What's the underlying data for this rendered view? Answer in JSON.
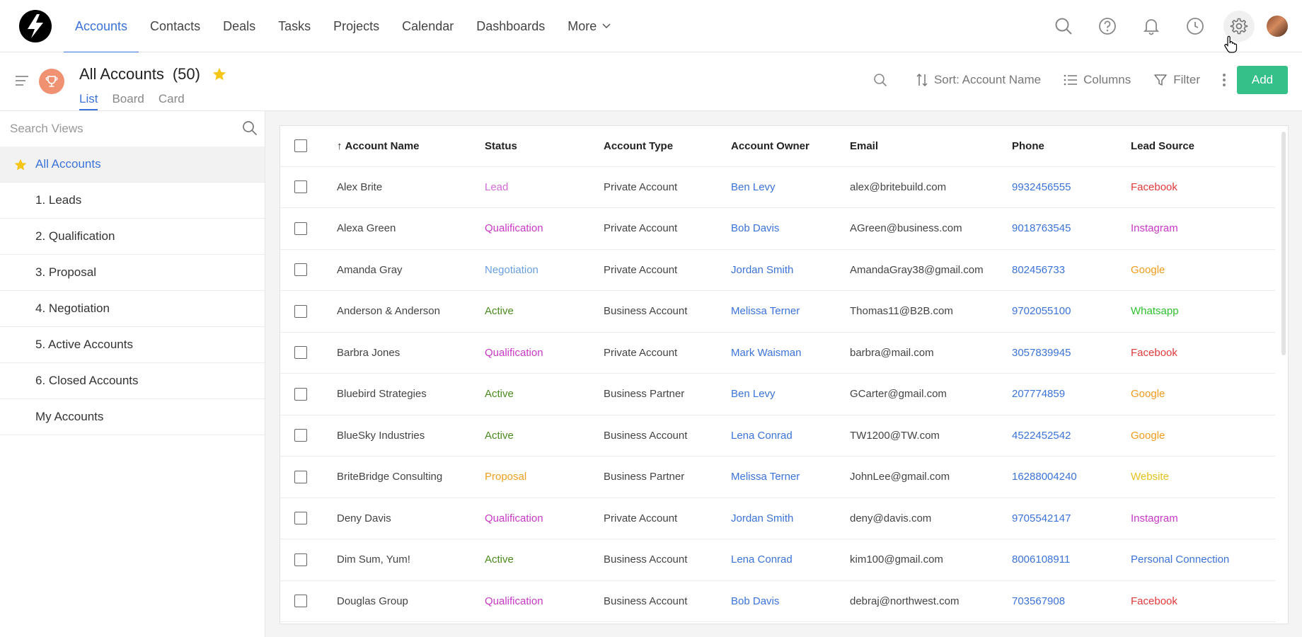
{
  "nav": {
    "items": [
      {
        "label": "Accounts",
        "active": true
      },
      {
        "label": "Contacts"
      },
      {
        "label": "Deals"
      },
      {
        "label": "Tasks"
      },
      {
        "label": "Projects"
      },
      {
        "label": "Calendar"
      },
      {
        "label": "Dashboards"
      }
    ],
    "more_label": "More",
    "icons": [
      "search-icon",
      "help-icon",
      "bell-icon",
      "clock-icon",
      "gear-icon",
      "avatar"
    ]
  },
  "header": {
    "title": "All Accounts",
    "count": "(50)",
    "tabs": [
      "List",
      "Board",
      "Card"
    ],
    "active_tab": "List",
    "sort_label": "Sort: Account Name",
    "columns_label": "Columns",
    "filter_label": "Filter",
    "add_label": "Add"
  },
  "sidebar": {
    "search_placeholder": "Search Views",
    "views": [
      {
        "label": "All Accounts",
        "active": true,
        "starred": true
      },
      {
        "label": "1. Leads"
      },
      {
        "label": "2. Qualification"
      },
      {
        "label": "3. Proposal"
      },
      {
        "label": "4. Negotiation"
      },
      {
        "label": "5. Active Accounts"
      },
      {
        "label": "6. Closed Accounts"
      },
      {
        "label": "My Accounts"
      }
    ]
  },
  "table": {
    "columns": [
      "Account Name",
      "Status",
      "Account Type",
      "Account Owner",
      "Email",
      "Phone",
      "Lead Source"
    ],
    "rows": [
      {
        "name": "Alex Brite",
        "status": "Lead",
        "type": "Private Account",
        "owner": "Ben Levy",
        "email": "alex@britebuild.com",
        "phone": "9932456555",
        "source": "Facebook"
      },
      {
        "name": "Alexa Green",
        "status": "Qualification",
        "type": "Private Account",
        "owner": "Bob Davis",
        "email": "AGreen@business.com",
        "phone": "9018763545",
        "source": "Instagram"
      },
      {
        "name": "Amanda Gray",
        "status": "Negotiation",
        "type": "Private Account",
        "owner": "Jordan Smith",
        "email": "AmandaGray38@gmail.com",
        "phone": "802456733",
        "source": "Google"
      },
      {
        "name": "Anderson & Anderson",
        "status": "Active",
        "type": "Business Account",
        "owner": "Melissa Terner",
        "email": "Thomas11@B2B.com",
        "phone": "9702055100",
        "source": "Whatsapp"
      },
      {
        "name": "Barbra Jones",
        "status": "Qualification",
        "type": "Private Account",
        "owner": "Mark Waisman",
        "email": "barbra@mail.com",
        "phone": "3057839945",
        "source": "Facebook"
      },
      {
        "name": "Bluebird Strategies",
        "status": "Active",
        "type": "Business Partner",
        "owner": "Ben Levy",
        "email": "GCarter@gmail.com",
        "phone": "207774859",
        "source": "Google"
      },
      {
        "name": "BlueSky Industries",
        "status": "Active",
        "type": "Business Account",
        "owner": "Lena Conrad",
        "email": "TW1200@TW.com",
        "phone": "4522452542",
        "source": "Google"
      },
      {
        "name": "BriteBridge Consulting",
        "status": "Proposal",
        "type": "Business Partner",
        "owner": "Melissa Terner",
        "email": "JohnLee@gmail.com",
        "phone": "16288004240",
        "source": "Website"
      },
      {
        "name": "Deny Davis",
        "status": "Qualification",
        "type": "Private Account",
        "owner": "Jordan Smith",
        "email": "deny@davis.com",
        "phone": "9705542147",
        "source": "Instagram"
      },
      {
        "name": "Dim Sum, Yum!",
        "status": "Active",
        "type": "Business Account",
        "owner": "Lena Conrad",
        "email": "kim100@gmail.com",
        "phone": "8006108911",
        "source": "Personal Connection"
      },
      {
        "name": "Douglas Group",
        "status": "Qualification",
        "type": "Business Account",
        "owner": "Bob Davis",
        "email": "debraj@northwest.com",
        "phone": "703567908",
        "source": "Facebook"
      }
    ]
  },
  "colors": {
    "accent": "#3b73d9",
    "add_button": "#35c08a",
    "status": {
      "Lead": "#d46bd6",
      "Qualification": "#c837c8",
      "Negotiation": "#6a9fe0",
      "Active": "#4b8a1e",
      "Proposal": "#f0a020"
    },
    "source": {
      "Facebook": "#e03a3a",
      "Instagram": "#c837c8",
      "Google": "#f09a1a",
      "Whatsapp": "#2ec12e",
      "Website": "#e6c21a",
      "Personal Connection": "#3b73d9"
    }
  }
}
